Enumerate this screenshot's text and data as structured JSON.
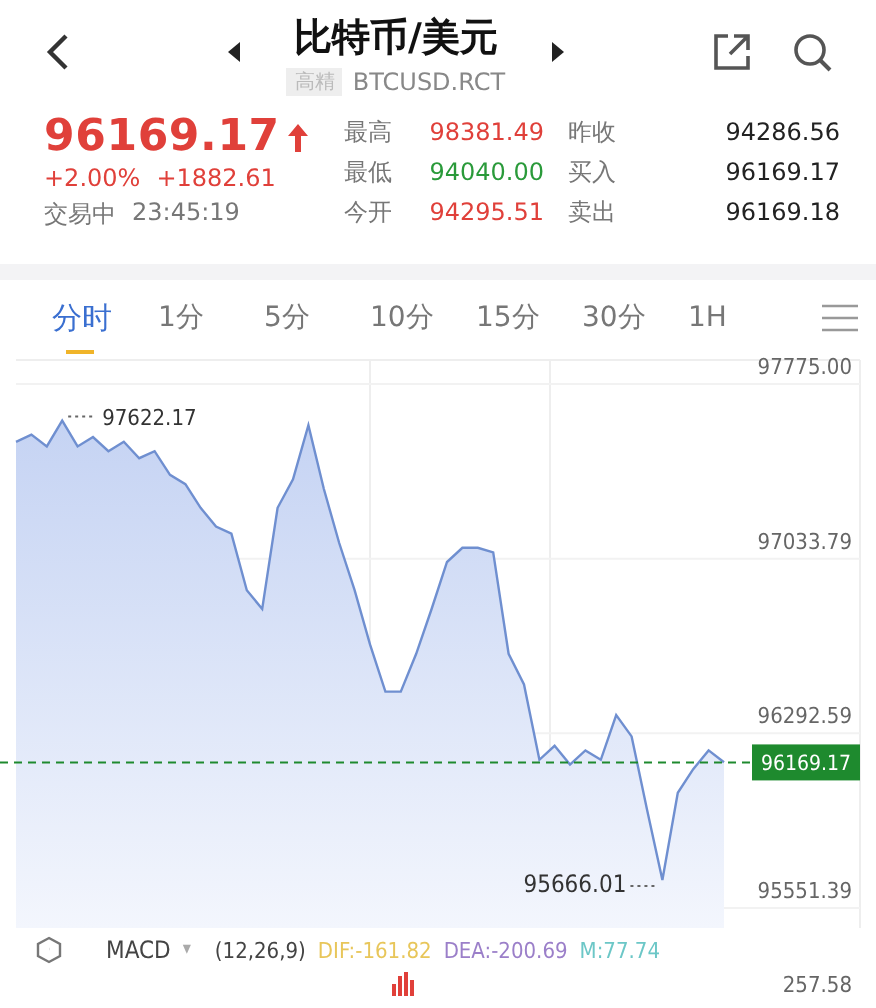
{
  "header": {
    "title": "比特币/美元",
    "badge": "高精",
    "symbol": "BTCUSD.RCT"
  },
  "quote": {
    "price": "96169.17",
    "change_pct": "+2.00%",
    "change": "+1882.61",
    "status": "交易中",
    "time": "23:45:19"
  },
  "stats": [
    {
      "label": "最高",
      "value": "98381.49",
      "color": "#e0403a"
    },
    {
      "label": "最低",
      "value": "94040.00",
      "color": "#2a9a3a"
    },
    {
      "label": "今开",
      "value": "94295.51",
      "color": "#e0403a"
    },
    {
      "label": "昨收",
      "value": "94286.56",
      "color": "#222222"
    },
    {
      "label": "买入",
      "value": "96169.17",
      "color": "#222222"
    },
    {
      "label": "卖出",
      "value": "96169.18",
      "color": "#222222"
    }
  ],
  "tabs": [
    {
      "label": "分时",
      "selected": true
    },
    {
      "label": "1分",
      "selected": false
    },
    {
      "label": "5分",
      "selected": false
    },
    {
      "label": "10分",
      "selected": false
    },
    {
      "label": "15分",
      "selected": false
    },
    {
      "label": "30分",
      "selected": false
    },
    {
      "label": "1H",
      "selected": false
    }
  ],
  "chart": {
    "chart_data": {
      "type": "area",
      "ylim": [
        95551.39,
        97775.0
      ],
      "yticks": [
        {
          "value": 97775.0,
          "label": "97775.00"
        },
        {
          "value": 97033.79,
          "label": "97033.79"
        },
        {
          "value": 96292.59,
          "label": "96292.59"
        },
        {
          "value": 95551.39,
          "label": "95551.39"
        }
      ],
      "series": [
        {
          "color": "#6f8fd0",
          "values": [
            97530,
            97560,
            97510,
            97620,
            97510,
            97550,
            97490,
            97530,
            97460,
            97490,
            97390,
            97350,
            97250,
            97170,
            97140,
            96900,
            96820,
            97250,
            97370,
            97600,
            97330,
            97100,
            96900,
            96670,
            96470,
            96470,
            96630,
            96820,
            97020,
            97080,
            97080,
            97060,
            96630,
            96500,
            96180,
            96240,
            96160,
            96220,
            96180,
            96370,
            96280,
            95970,
            95670,
            96040,
            96140,
            96220,
            96170
          ]
        }
      ],
      "grid": true,
      "annotations": [
        "97622.17",
        "95666.01"
      ],
      "ref_lines": [
        {
          "axis": "y",
          "value": 96169.17,
          "label": "96169.17",
          "color": "#1e8a2e"
        }
      ]
    }
  },
  "indicator": {
    "name": "MACD",
    "caret": "▾",
    "params": "(12,26,9)",
    "lines": [
      {
        "text": "DIF:-161.82",
        "color": "#e8c65a"
      },
      {
        "text": "DEA:-200.69",
        "color": "#9b7fc9"
      },
      {
        "text": "M:77.74",
        "color": "#6cc7c7"
      }
    ],
    "scale": "257.58"
  }
}
